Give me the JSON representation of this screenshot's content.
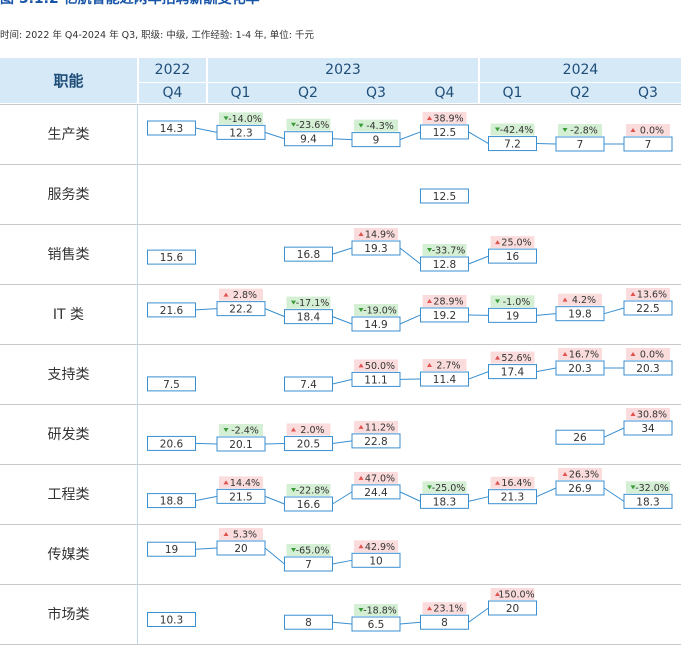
{
  "title": "图 5.1.2 亿航智能近两年招聘薪酬变化率",
  "subtitle": "时间: 2022 年 Q4-2024 年 Q3, 职级: 中级, 工作经验: 1-4 年, 单位: 千元",
  "header": {
    "function_label": "职能",
    "years": [
      "2022",
      "2023",
      "2024"
    ],
    "quarters": [
      "Q4",
      "Q1",
      "Q2",
      "Q3",
      "Q4",
      "Q1",
      "Q2",
      "Q3"
    ]
  },
  "colors": {
    "header_bg": "#d6e9f7",
    "box_border": "#3a8fd0",
    "line": "#3a8fd0",
    "up_bg": "#fbdcdc",
    "up_arrow": "#e0524f",
    "down_bg": "#d5efd5",
    "down_arrow": "#3a9a3a"
  },
  "chart_data": {
    "type": "table",
    "x": [
      "2022 Q4",
      "2023 Q1",
      "2023 Q2",
      "2023 Q3",
      "2023 Q4",
      "2024 Q1",
      "2024 Q2",
      "2024 Q3"
    ],
    "rows": [
      {
        "name": "生产类",
        "values": [
          14.3,
          12.3,
          9.4,
          9,
          12.5,
          7.2,
          7,
          7
        ],
        "changes": [
          null,
          "-14.0%",
          "-23.6%",
          "-4.3%",
          "38.9%",
          "-42.4%",
          "-2.8%",
          "0.0%"
        ]
      },
      {
        "name": "服务类",
        "values": [
          null,
          null,
          null,
          null,
          12.5,
          null,
          null,
          null
        ],
        "changes": [
          null,
          null,
          null,
          null,
          null,
          null,
          null,
          null
        ]
      },
      {
        "name": "销售类",
        "values": [
          15.6,
          null,
          16.8,
          19.3,
          12.8,
          16,
          null,
          null
        ],
        "changes": [
          null,
          null,
          null,
          "14.9%",
          "-33.7%",
          "25.0%",
          null,
          null
        ]
      },
      {
        "name": "IT 类",
        "values": [
          21.6,
          22.2,
          18.4,
          14.9,
          19.2,
          19,
          19.8,
          22.5
        ],
        "changes": [
          null,
          "2.8%",
          "-17.1%",
          "-19.0%",
          "28.9%",
          "-1.0%",
          "4.2%",
          "13.6%"
        ]
      },
      {
        "name": "支持类",
        "values": [
          7.5,
          null,
          7.4,
          11.1,
          11.4,
          17.4,
          20.3,
          20.3
        ],
        "changes": [
          null,
          null,
          null,
          "50.0%",
          "2.7%",
          "52.6%",
          "16.7%",
          "0.0%"
        ]
      },
      {
        "name": "研发类",
        "values": [
          20.6,
          20.1,
          20.5,
          22.8,
          null,
          null,
          26,
          34
        ],
        "changes": [
          null,
          "-2.4%",
          "2.0%",
          "11.2%",
          null,
          null,
          null,
          "30.8%"
        ]
      },
      {
        "name": "工程类",
        "values": [
          18.8,
          21.5,
          16.6,
          24.4,
          18.3,
          21.3,
          26.9,
          18.3
        ],
        "changes": [
          null,
          "14.4%",
          "-22.8%",
          "47.0%",
          "-25.0%",
          "16.4%",
          "26.3%",
          "-32.0%"
        ]
      },
      {
        "name": "传媒类",
        "values": [
          19,
          20,
          7,
          10,
          null,
          null,
          null,
          null
        ],
        "changes": [
          null,
          "5.3%",
          "-65.0%",
          "42.9%",
          null,
          null,
          null,
          null
        ]
      },
      {
        "name": "市场类",
        "values": [
          10.3,
          null,
          8,
          6.5,
          8,
          20,
          null,
          null
        ],
        "changes": [
          null,
          null,
          null,
          "-18.8%",
          "23.1%",
          "150.0%",
          null,
          null
        ]
      }
    ]
  }
}
